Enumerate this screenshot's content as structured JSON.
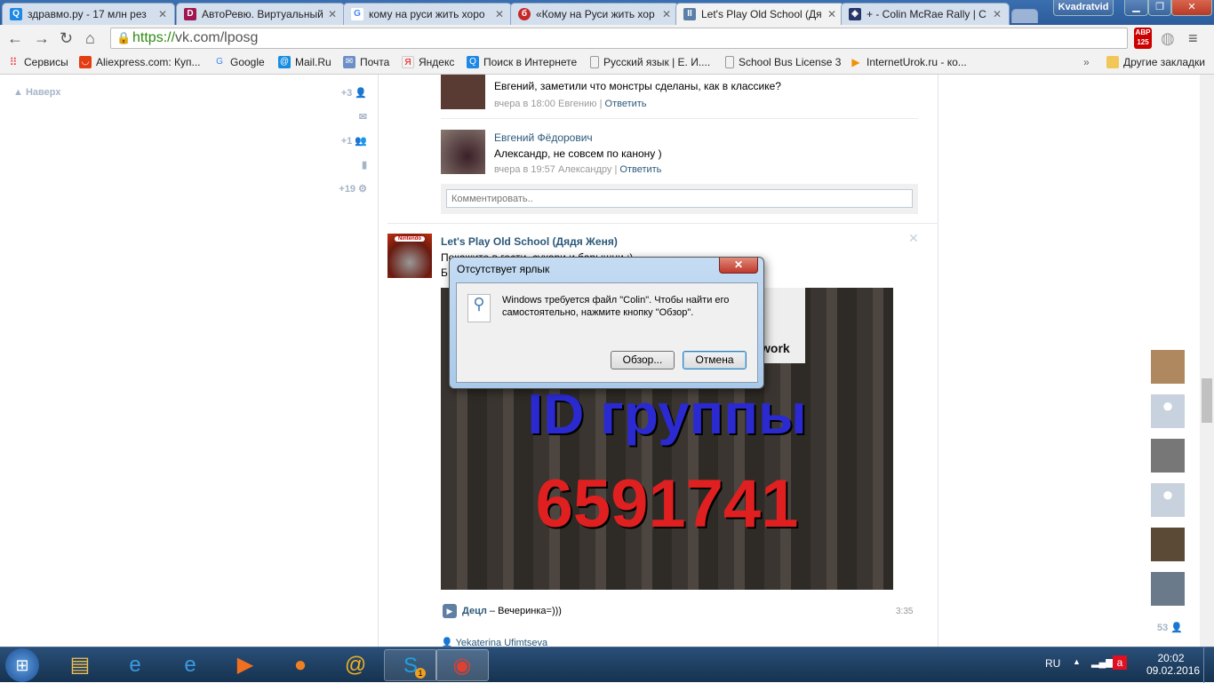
{
  "browser": {
    "tabs": [
      {
        "title": "здравмо.ру - 17 млн рез",
        "icon": "search-icon",
        "color": "#1e88e5"
      },
      {
        "title": "АвтоРевю. Виртуальный",
        "icon": "D",
        "color": "#a0174f"
      },
      {
        "title": "кому на руси жить хоро",
        "icon": "G",
        "color": "#4285f4"
      },
      {
        "title": "«Кому на Руси жить хор",
        "icon": "б",
        "color": "#c62828"
      },
      {
        "title": "Let's Play Old School (Дя",
        "icon": "II",
        "color": "#5a7fa8"
      },
      {
        "title": "+ - Colin McRae Rally | C",
        "icon": "◈",
        "color": "#24366a"
      }
    ],
    "profile": "Kvadratvid",
    "url_secure": "https://",
    "url_rest": "vk.com/lposg",
    "abp_count": "125",
    "bookmarks": [
      "Сервисы",
      "Aliexpress.com: Куп...",
      "Google",
      "Mail.Ru",
      "Почта",
      "Яндекс",
      "Поиск в Интернете",
      "Русский язык | Е. И....",
      "School Bus License 3",
      "InternetUrok.ru - ко..."
    ],
    "more": "»",
    "other_bookmarks": "Другие закладки"
  },
  "left": {
    "up": "Наверх",
    "friends": "+3",
    "groups": "+1",
    "notifications": "+19"
  },
  "comments": [
    {
      "text": "Евгений, заметили что монстры сделаны, как в классике?",
      "time": "вчера в 18:00",
      "to": "Евгению",
      "reply": "Ответить"
    },
    {
      "author": "Евгений Фёдорович",
      "text": "Александр, не совсем по канону )",
      "time": "вчера в 19:57",
      "to": "Александру",
      "reply": "Ответить"
    }
  ],
  "comment_placeholder": "Комментировать..",
  "post": {
    "author": "Let's Play Old School (Дядя Женя)",
    "line1": "Покажите в гости, сухари и барышни :)",
    "line2": "Б",
    "image_line1": "ID группы",
    "image_line2": "6591741",
    "image_partial": "work",
    "avatar_logo": "Nintendo SEGA",
    "audio_artist": "Децл",
    "audio_sep": " – ",
    "audio_title": "Вечеринка=)))",
    "audio_duration": "3:35",
    "liker": "Yekaterina Ufimtseva"
  },
  "friends_count": "53",
  "dialog": {
    "title": "Отсутствует ярлык",
    "message": "Windows требуется файл \"Colin\". Чтобы найти его самостоятельно, нажмите кнопку \"Обзор\".",
    "browse": "Обзор...",
    "cancel": "Отмена"
  },
  "taskbar": {
    "lang": "RU",
    "time": "20:02",
    "date": "09.02.2016",
    "skype_badge": "1"
  }
}
